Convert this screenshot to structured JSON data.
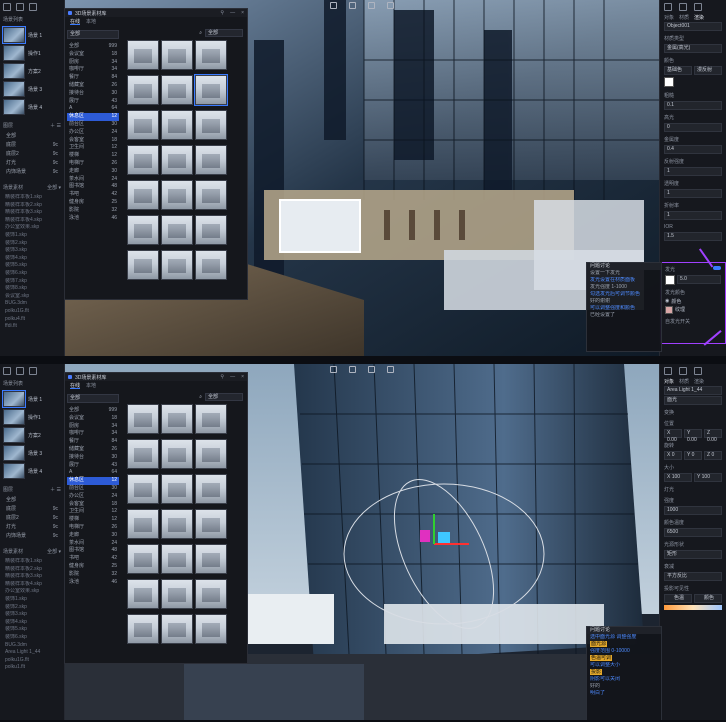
{
  "top": {
    "left_panel": {
      "title": "场景列表",
      "scenes": [
        "场景 1",
        "操作1",
        "方案2",
        "场景 3",
        "场景 4"
      ],
      "layers_title": "图层",
      "layers": [
        [
          "全部",
          ""
        ],
        [
          "底层",
          "9c"
        ],
        [
          "底层2",
          "9c"
        ],
        [
          "灯光",
          "9c"
        ],
        [
          "内饰场景",
          "9c"
        ]
      ],
      "assets_title": "场景素材",
      "assets_filter": "全部 ▾",
      "files": [
        "精装样本板1.skp",
        "精装样本板2.skp",
        "精装样本板3.skp",
        "精装样本板4.skp",
        "办公室效果.skp",
        "装饰1.skp",
        "装饰2.skp",
        "装饰3.skp",
        "装饰4.skp",
        "装饰5.skp",
        "装饰6.skp",
        "装饰7.skp",
        "装饰8.skp",
        "会议室.skp",
        "BUG.3dm",
        "polku1G.flt",
        "polku4.flt",
        "ffdi.flt"
      ]
    },
    "asset_window": {
      "title": "3D场景素材库",
      "tabs": [
        "在线",
        "本地"
      ],
      "dropdown": "全部",
      "search": "全部",
      "categories": [
        [
          "全部",
          "999"
        ],
        [
          "会议室",
          "18"
        ],
        [
          "厨房",
          "34"
        ],
        [
          "咖啡厅",
          "34"
        ],
        [
          "餐厅",
          "84"
        ],
        [
          "储藏室",
          "26"
        ],
        [
          "接待台",
          "30"
        ],
        [
          "展厅",
          "43"
        ],
        [
          "A",
          "64"
        ],
        [
          "休息区",
          "12"
        ],
        [
          "前台区",
          "30"
        ],
        [
          "办公区",
          "24"
        ],
        [
          "会客室",
          "18"
        ],
        [
          "卫生间",
          "12"
        ],
        [
          "楼梯",
          "12"
        ],
        [
          "电梯厅",
          "26"
        ],
        [
          "走廊",
          "30"
        ],
        [
          "茶水间",
          "24"
        ],
        [
          "图书馆",
          "48"
        ],
        [
          "书吧",
          "42"
        ],
        [
          "健身房",
          "25"
        ],
        [
          "影院",
          "32"
        ],
        [
          "泳池",
          "46"
        ]
      ],
      "selected_category": 9
    },
    "right_panel": {
      "tabs": [
        "对象",
        "材质",
        "渲染"
      ],
      "obj_name": "Object001",
      "section1": "材质类型",
      "mat_type": "金属(高光)",
      "section2": "颜色",
      "mode_a": "基础色",
      "mode_b": "漫反射",
      "fields": [
        [
          "粗糙",
          "0.1"
        ],
        [
          "高光",
          "0"
        ],
        [
          "金属度",
          "0.4"
        ],
        [
          "反射强度",
          "1"
        ],
        [
          "透明度",
          "1"
        ],
        [
          "折射率",
          "1"
        ],
        [
          "IOR",
          "1.5"
        ]
      ],
      "hl_title": "发光",
      "hl_value": "5.0",
      "hl_color": "发光颜色",
      "hl_hue": "颜色",
      "hl_tex": "纹理",
      "hl_bottom": "自发光开关"
    },
    "chat": {
      "title": "问题讨论",
      "lines": [
        [
          "a",
          "设置一下发光"
        ],
        [
          "b",
          "发光设置在材质面板"
        ],
        [
          "a",
          "发光强度 1-1000"
        ],
        [
          "b",
          "勾选发光后可调节颜色"
        ],
        [
          "a",
          "好的谢谢"
        ],
        [
          "b",
          "可以调整强度和颜色"
        ],
        [
          "a",
          "已经设置了"
        ]
      ]
    }
  },
  "bottom": {
    "left_panel": {
      "title": "场景列表",
      "scenes": [
        "场景 1",
        "操作1",
        "方案2",
        "场景 3",
        "场景 4"
      ],
      "layers_title": "图层",
      "layers": [
        [
          "全部",
          ""
        ],
        [
          "底层",
          "9c"
        ],
        [
          "底层2",
          "9c"
        ],
        [
          "灯光",
          "9c"
        ],
        [
          "内饰场景",
          "9c"
        ]
      ],
      "assets_title": "场景素材",
      "assets_filter": "全部 ▾",
      "files": [
        "精装样本板1.skp",
        "精装样本板2.skp",
        "精装样本板3.skp",
        "精装样本板4.skp",
        "办公室效果.skp",
        "装饰1.skp",
        "装饰2.skp",
        "装饰3.skp",
        "装饰4.skp",
        "装饰5.skp",
        "装饰6.skp",
        "BUG.3dm",
        "Area Light 1_44",
        "polku1G.flt",
        "polku1.flt"
      ]
    },
    "right_panel": {
      "tabs": [
        "对象",
        "材质",
        "渲染"
      ],
      "obj_name": "Area Light 1_44",
      "type": "面光",
      "section1": "变换",
      "pos_label": "位置",
      "pos": [
        "X 0.00",
        "Y 0.00",
        "Z 0.00"
      ],
      "rot_label": "旋转",
      "rot": [
        "X 0",
        "Y 0",
        "Z 0"
      ],
      "scale_label": "大小",
      "scale": [
        "X 100",
        "Y 100"
      ],
      "light": "灯光",
      "fields": [
        [
          "强度",
          "1000"
        ],
        [
          "颜色温度",
          "6500"
        ],
        [
          "光源形状",
          "矩形"
        ],
        [
          "衰减",
          "平方反比"
        ]
      ],
      "shadow": "投影可见性",
      "btn_a": "色温",
      "btn_b": "颜色"
    },
    "chat": {
      "title": "问题讨论",
      "lines": [
        [
          "b",
          "选中面光源 调整强度"
        ],
        [
          "a",
          "面光源",
          "tag"
        ],
        [
          "b",
          "强度范围 0-10000"
        ],
        [
          "a",
          "色温可调",
          "tag"
        ],
        [
          "b",
          "可以调整大小"
        ],
        [
          "a",
          "投影",
          "tag"
        ],
        [
          "b",
          "阴影可以关闭"
        ],
        [
          "a",
          "好的"
        ],
        [
          "b",
          "明白了"
        ]
      ]
    }
  }
}
